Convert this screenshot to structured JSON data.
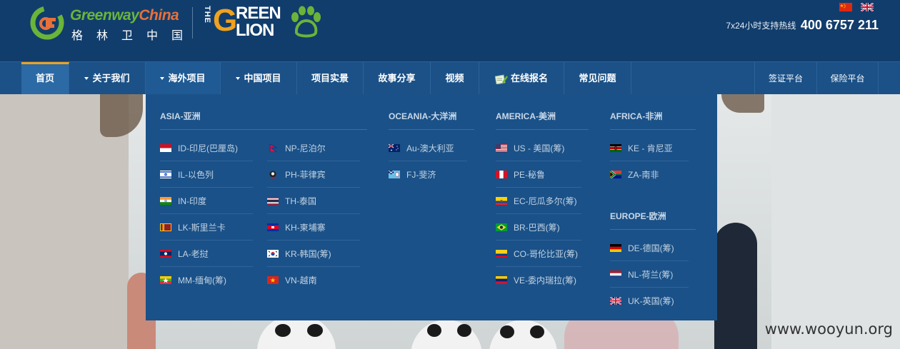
{
  "header": {
    "brand_en_green": "Greenway",
    "brand_en_orange": "China",
    "brand_cn": "格林卫中国",
    "logo2_the": "THE",
    "logo2_g": "G",
    "logo2_reen": "REEN",
    "logo2_lion": "LION",
    "hotline_label": "7x24小时支持热线",
    "hotline_number": "400 6757 211",
    "lang_flags": [
      "china-flag-icon",
      "uk-flag-icon"
    ]
  },
  "nav": {
    "home": "首页",
    "about": "关于我们",
    "overseas": "海外项目",
    "china": "中国项目",
    "real": "项目实景",
    "stories": "故事分享",
    "video": "视频",
    "signup": "在线报名",
    "faq": "常见问题",
    "visa": "签证平台",
    "insurance": "保险平台"
  },
  "dropdown": {
    "asia_title": "ASIA-亚洲",
    "oceania_title": "OCEANIA-大洋洲",
    "america_title": "AMERICA-美洲",
    "africa_title": "AFRICA-非洲",
    "europe_title": "EUROPE-欧洲",
    "asia_col1": [
      "ID-印尼(巴厘岛)",
      "IL-以色列",
      "IN-印度",
      "LK-斯里兰卡",
      "LA-老挝",
      "MM-缅甸(筹)"
    ],
    "asia_col2": [
      "NP-尼泊尔",
      "PH-菲律宾",
      "TH-泰国",
      "KH-柬埔寨",
      "KR-韩国(筹)",
      "VN-越南"
    ],
    "oceania": [
      "Au-澳大利亚",
      "FJ-斐济"
    ],
    "america": [
      "US - 美国(筹)",
      "PE-秘鲁",
      "EC-厄瓜多尔(筹)",
      "BR-巴西(筹)",
      "CO-哥伦比亚(筹)",
      "VE-委内瑞拉(筹)"
    ],
    "africa": [
      "KE - 肯尼亚",
      "ZA-南非"
    ],
    "europe": [
      "DE-德国(筹)",
      "NL-荷兰(筹)",
      "UK-英国(筹)"
    ]
  },
  "watermark": "www.wooyun.org",
  "colors": {
    "header_bg": "#113d6c",
    "nav_bg": "#1b5187",
    "dropdown_bg": "#1a5188",
    "accent": "#f0a21e",
    "brand_green": "#6ab43a"
  }
}
